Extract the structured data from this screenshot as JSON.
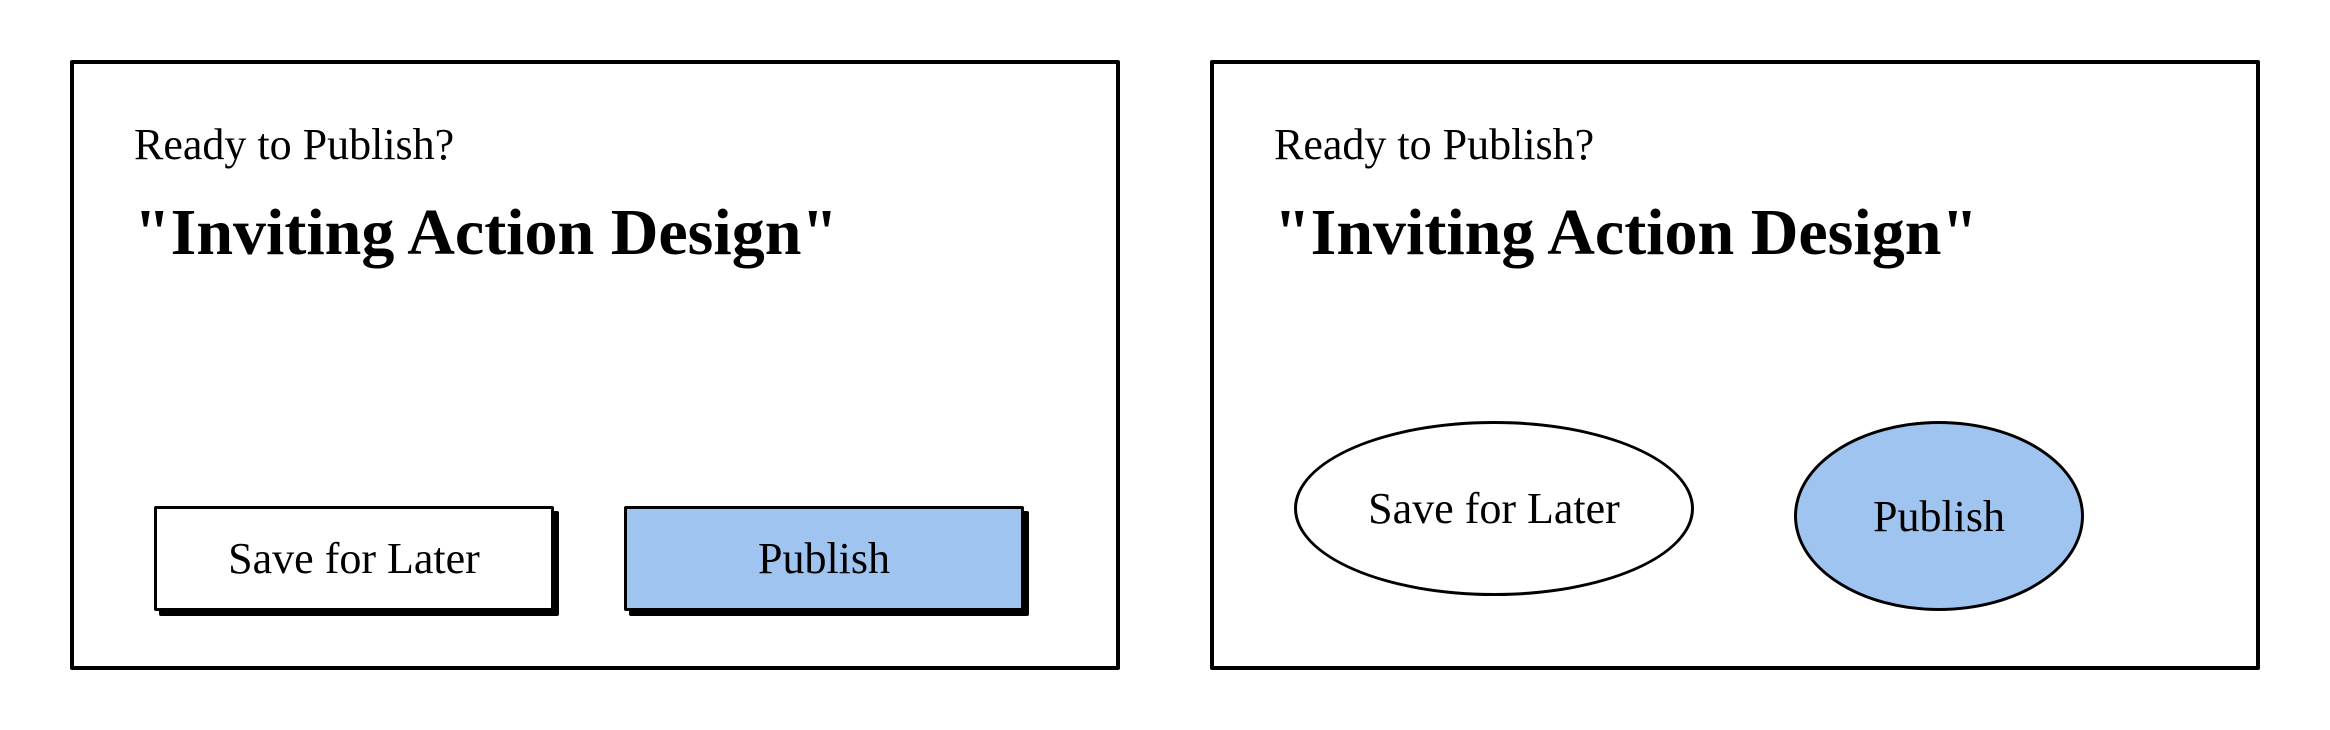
{
  "left": {
    "prompt": "Ready to Publish?",
    "title": "\"Inviting Action Design\"",
    "saveLabel": "Save for Later",
    "publishLabel": "Publish"
  },
  "right": {
    "prompt": "Ready to Publish?",
    "title": "\"Inviting Action Design\"",
    "saveLabel": "Save for Later",
    "publishLabel": "Publish"
  }
}
